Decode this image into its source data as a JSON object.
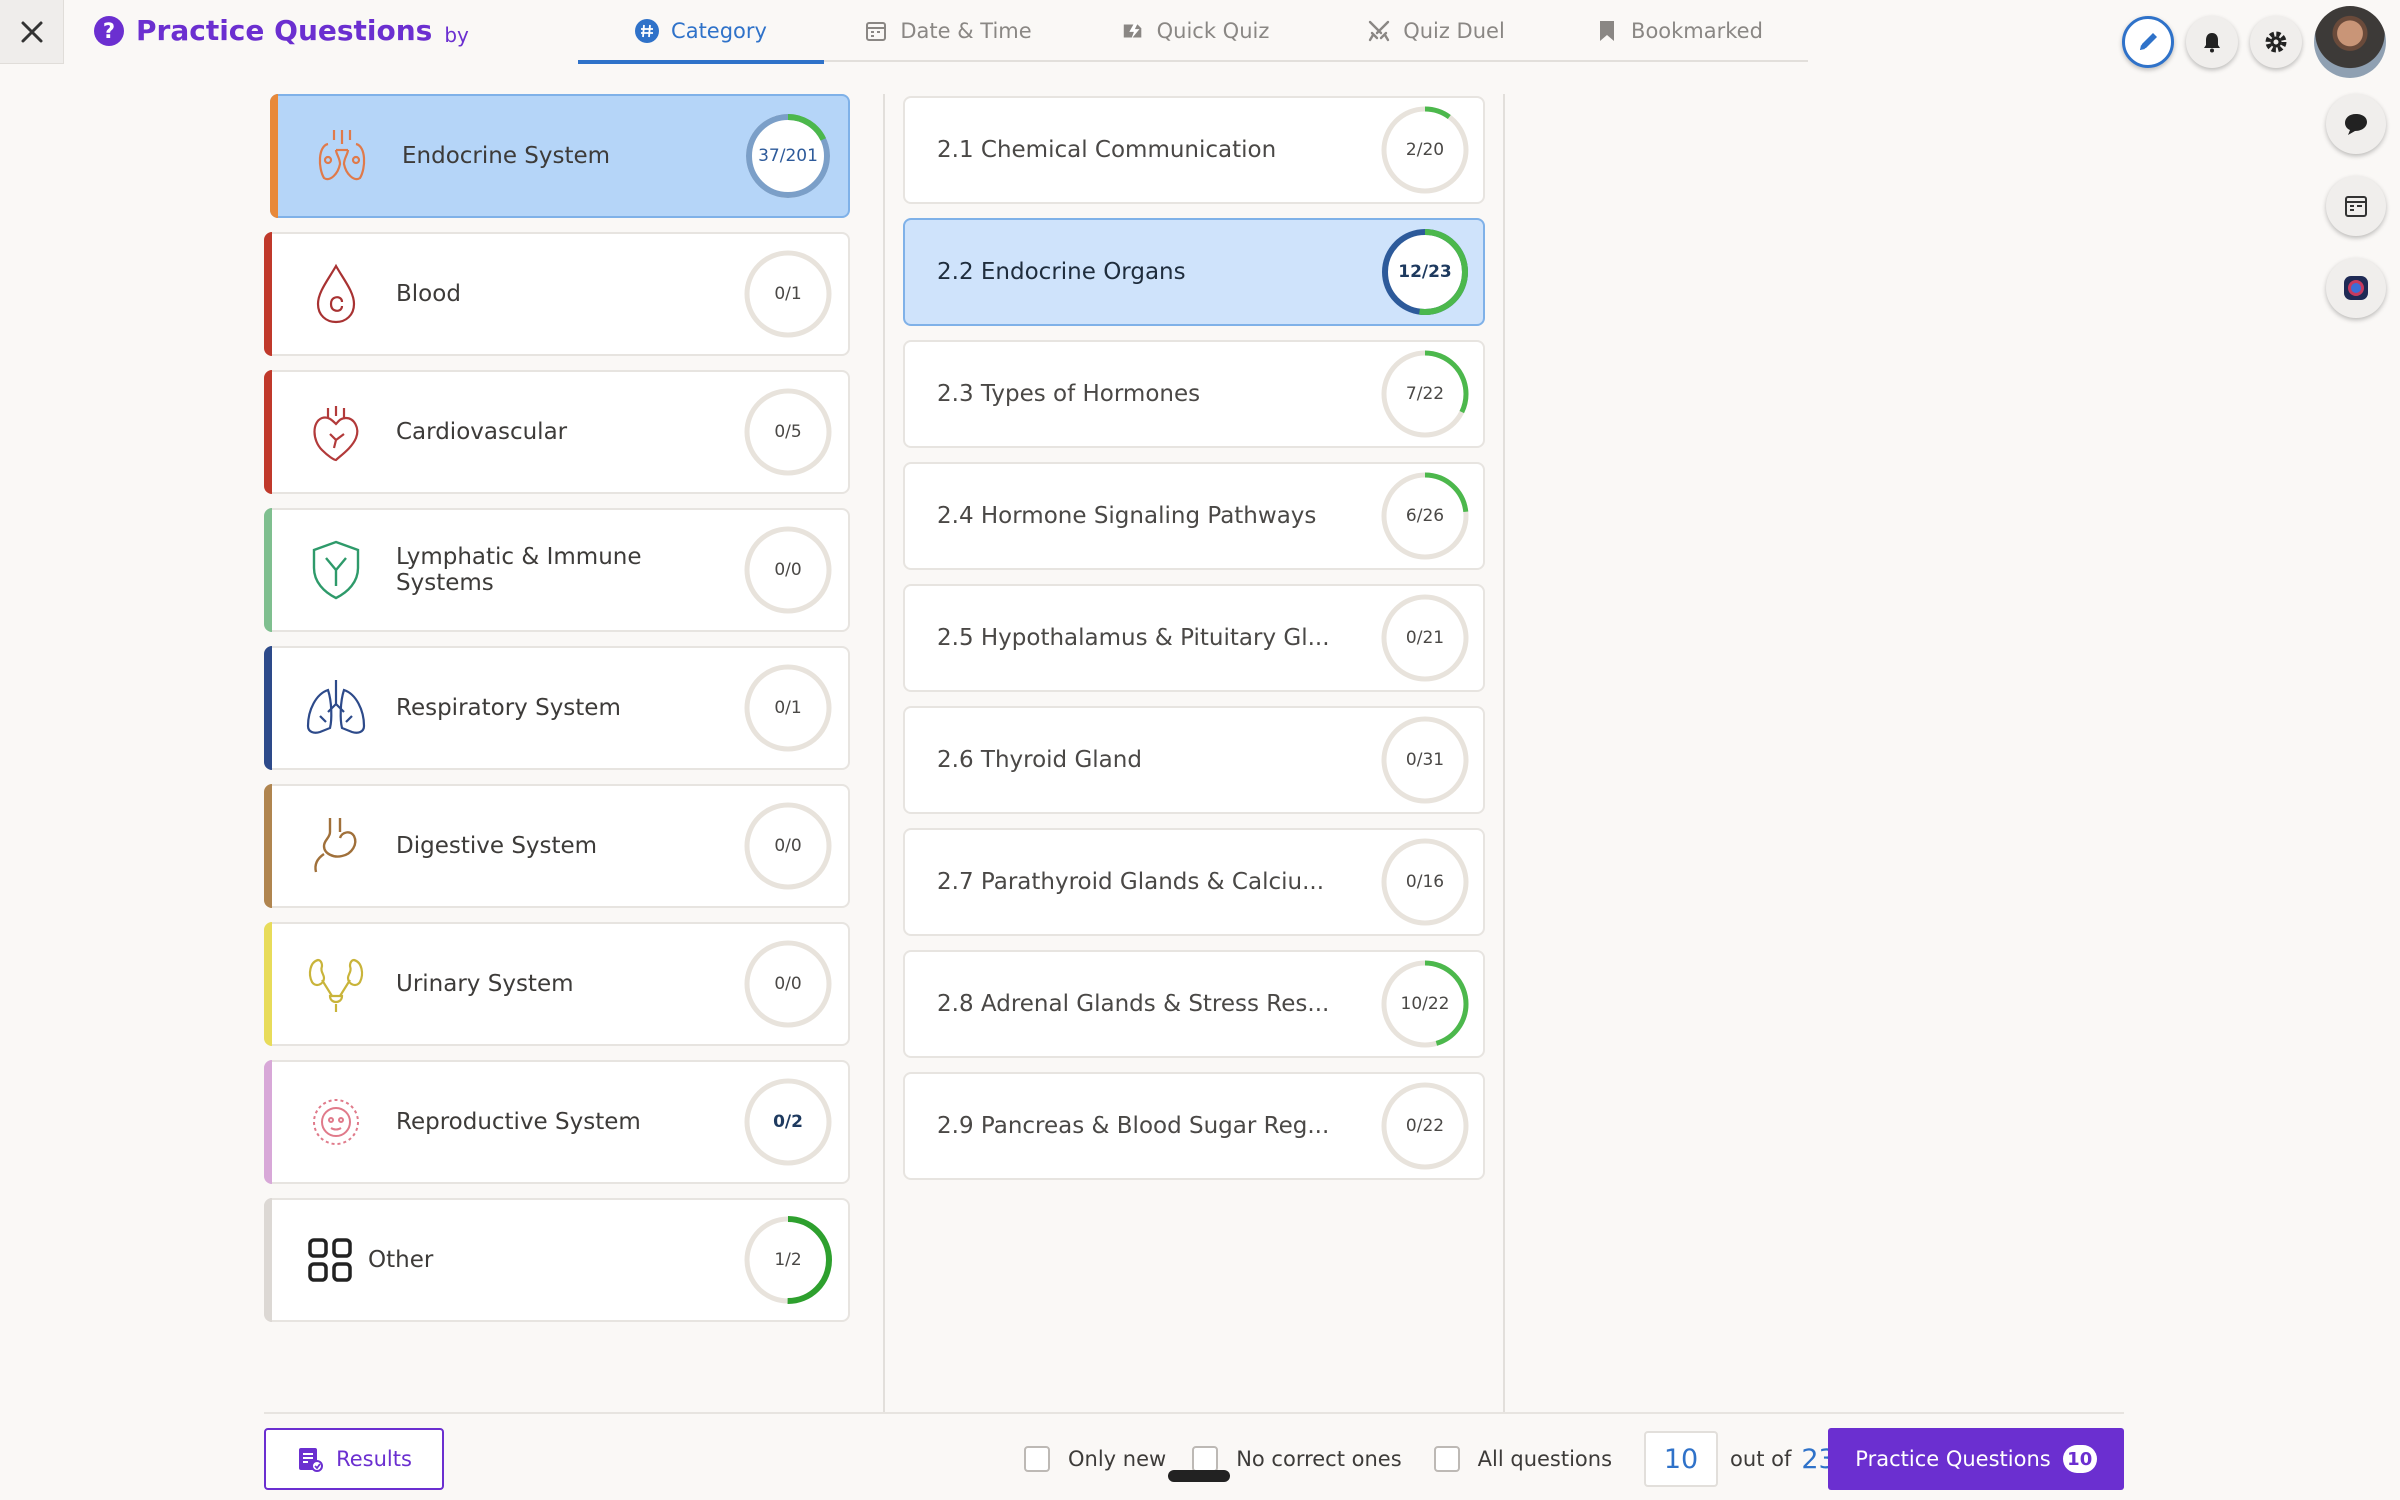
{
  "header": {
    "title": "Practice Questions",
    "by": "by"
  },
  "tabs": [
    {
      "label": "Category",
      "icon": "hash-icon",
      "active": true
    },
    {
      "label": "Date & Time",
      "icon": "calendar-icon"
    },
    {
      "label": "Quick Quiz",
      "icon": "lightning-icon"
    },
    {
      "label": "Quiz Duel",
      "icon": "swords-icon"
    },
    {
      "label": "Bookmarked",
      "icon": "bookmark-icon"
    }
  ],
  "categories": [
    {
      "label": "Endocrine System",
      "progress": "37/201",
      "fraction": 0.18,
      "color": "#e8893a",
      "icon": "thyroid-icon",
      "selected": true
    },
    {
      "label": "Blood",
      "progress": "0/1",
      "fraction": 0,
      "color": "#c0392b",
      "icon": "blood-drop-icon"
    },
    {
      "label": "Cardiovascular",
      "progress": "0/5",
      "fraction": 0,
      "color": "#c0392b",
      "icon": "heart-icon"
    },
    {
      "label": "Lymphatic & Immune Systems",
      "progress": "0/0",
      "fraction": 0,
      "color": "#7fbf8f",
      "icon": "shield-icon"
    },
    {
      "label": "Respiratory System",
      "progress": "0/1",
      "fraction": 0,
      "color": "#2d4a8a",
      "icon": "lungs-icon"
    },
    {
      "label": "Digestive System",
      "progress": "0/0",
      "fraction": 0,
      "color": "#b0854f",
      "icon": "stomach-icon"
    },
    {
      "label": "Urinary System",
      "progress": "0/0",
      "fraction": 0,
      "color": "#e8dc5a",
      "icon": "kidneys-icon"
    },
    {
      "label": "Reproductive System",
      "progress": "0/2",
      "fraction": 0,
      "color": "#d8a8d8",
      "icon": "embryo-icon"
    },
    {
      "label": "Other",
      "progress": "1/2",
      "fraction": 0.5,
      "color": "#dcd8d4",
      "icon": "grid-icon"
    }
  ],
  "subcategories": [
    {
      "label": "2.1 Chemical Communication",
      "progress": "2/20",
      "fraction": 0.1
    },
    {
      "label": "2.2 Endocrine Organs",
      "progress": "12/23",
      "fraction": 0.52,
      "selected": true
    },
    {
      "label": "2.3 Types of Hormones",
      "progress": "7/22",
      "fraction": 0.32
    },
    {
      "label": "2.4 Hormone Signaling Pathways",
      "progress": "6/26",
      "fraction": 0.23
    },
    {
      "label": "2.5 Hypothalamus & Pituitary Gl...",
      "progress": "0/21",
      "fraction": 0
    },
    {
      "label": "2.6 Thyroid Gland",
      "progress": "0/31",
      "fraction": 0
    },
    {
      "label": "2.7 Parathyroid Glands & Calciu...",
      "progress": "0/16",
      "fraction": 0
    },
    {
      "label": "2.8 Adrenal Glands & Stress Res...",
      "progress": "10/22",
      "fraction": 0.45
    },
    {
      "label": "2.9 Pancreas & Blood Sugar Reg...",
      "progress": "0/22",
      "fraction": 0
    }
  ],
  "bottom": {
    "results_label": "Results",
    "only_new": "Only new",
    "no_correct": "No correct ones",
    "all_questions": "All questions",
    "count": "10",
    "out_of": "out of",
    "total": "23",
    "practice_label": "Practice Questions",
    "practice_badge": "10"
  },
  "colors": {
    "accent": "#6b2fd0",
    "tab_active": "#2f72c9",
    "ring_green": "#4cb84c",
    "ring_track": "#e8e3dc",
    "ring_selected_dark": "#2d5a9a"
  }
}
